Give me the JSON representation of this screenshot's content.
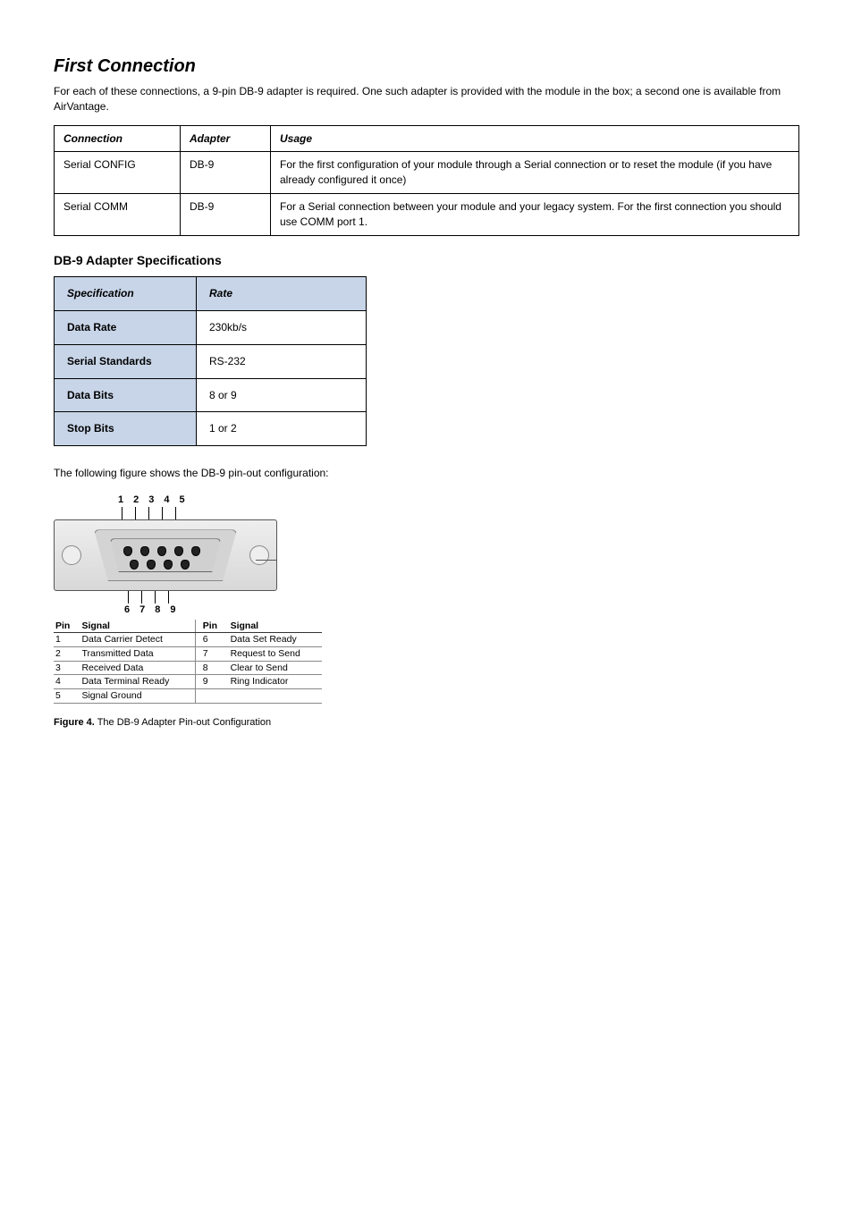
{
  "section_title": "First Connection",
  "intro": "For each of these connections, a 9-pin DB-9 adapter is required. One such adapter is provided with the module in the box; a second one is available from AirVantage.",
  "table1": {
    "headers": [
      "Connection",
      "Adapter",
      "Usage"
    ],
    "rows": [
      {
        "c0": "Serial CONFIG",
        "c1": "DB-9",
        "c2": "For the first configuration of your module through a Serial connection or to reset the module (if you have already configured it once)"
      },
      {
        "c0": "Serial COMM",
        "c1": "DB-9",
        "c2": "For a Serial connection between your module and your legacy system. For the first connection you should use COMM port 1."
      }
    ]
  },
  "spec_heading": "DB-9 Adapter Specifications",
  "spec_table": {
    "headers": [
      "Specification",
      "Rate"
    ],
    "rows": [
      {
        "label": "Data Rate",
        "value": "230kb/s"
      },
      {
        "label": "Serial Standards",
        "value": "RS-232"
      },
      {
        "label": "Data Bits",
        "value": "8 or 9"
      },
      {
        "label": "Stop Bits",
        "value": "1 or 2"
      }
    ]
  },
  "fig_text": "The following figure shows the DB-9 pin-out configuration:",
  "pin_out": {
    "top_nums": [
      "1",
      "2",
      "3",
      "4",
      "5"
    ],
    "bottom_nums": [
      "6",
      "7",
      "8",
      "9"
    ],
    "headers": {
      "pin": "Pin",
      "signal": "Signal"
    },
    "left": [
      {
        "pin": "1",
        "signal": "Data Carrier Detect"
      },
      {
        "pin": "2",
        "signal": "Transmitted Data"
      },
      {
        "pin": "3",
        "signal": "Received Data"
      },
      {
        "pin": "4",
        "signal": "Data  Terminal Ready"
      },
      {
        "pin": "5",
        "signal": "Signal Ground"
      }
    ],
    "right": [
      {
        "pin": "6",
        "signal": "Data Set Ready"
      },
      {
        "pin": "7",
        "signal": "Request to Send"
      },
      {
        "pin": "8",
        "signal": "Clear to Send"
      },
      {
        "pin": "9",
        "signal": "Ring Indicator"
      }
    ]
  },
  "caption": {
    "fig": "Figure 4.",
    "body": " The DB-9 Adapter Pin-out Configuration"
  }
}
